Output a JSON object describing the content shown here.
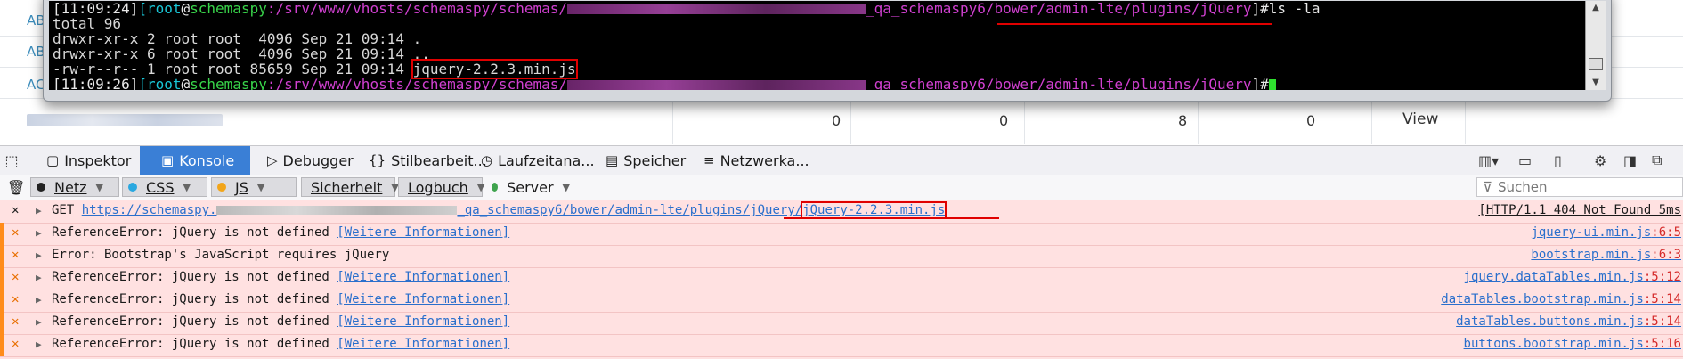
{
  "page": {
    "left_labels": [
      "AB",
      "AB",
      "AC"
    ],
    "numbers": [
      "0",
      "0",
      "8",
      "0"
    ],
    "view_link": "View"
  },
  "terminal": {
    "prompt1_time": "[11:09:24]",
    "prompt_user": "root",
    "prompt_at": "@",
    "prompt_host": "schemaspy",
    "prompt_path_prefix": ":/srv/www/vhosts/schemaspy/schemas/",
    "prompt_path_suffix": "_qa_schemaspy6/bower/admin-lte/plugins/jQuery",
    "prompt_end": "]#",
    "command": "ls -la",
    "lines": [
      "total 96",
      "drwxr-xr-x 2 root root  4096 Sep 21 09:14 .",
      "drwxr-xr-x 6 root root  4096 Sep 21 09:14 ..",
      "-rw-r--r-- 1 root root 85659 Sep 21 09:14 "
    ],
    "file_name": "jquery-2.2.3.min.js",
    "prompt2_time": "[11:09:26]",
    "prompt_bracket_open": "[",
    "scroll_up": "▲",
    "scroll_down": "▼"
  },
  "devtools": {
    "tabs": [
      {
        "icon": "▢",
        "label": "Inspektor"
      },
      {
        "icon": "▣",
        "label": "Konsole"
      },
      {
        "icon": "▷",
        "label": "Debugger"
      },
      {
        "icon": "{}",
        "label": "Stilbearbeit..."
      },
      {
        "icon": "◷",
        "label": "Laufzeitana..."
      },
      {
        "icon": "▤",
        "label": "Speicher"
      },
      {
        "icon": "≡",
        "label": "Netzwerka..."
      }
    ],
    "filters": [
      {
        "label": "Netz",
        "color": "#222222"
      },
      {
        "label": "CSS",
        "color": "#2aa8e0"
      },
      {
        "label": "JS",
        "color": "#f2a51a"
      },
      {
        "label": "Sicherheit",
        "color": "#e53b3b"
      },
      {
        "label": "Logbuch",
        "color": "#9a9a9a"
      },
      {
        "label": "Server",
        "color": "#3fa34d"
      }
    ],
    "search_placeholder": "Suchen",
    "trash_icon": "🗑",
    "filter_icon": "⊽"
  },
  "console": {
    "get_prefix": "GET ",
    "get_url_start": "https://schemaspy.",
    "get_url_mid": "_qa_schemaspy6/bower/admin-lte/plugins/jQuery/",
    "get_file": "jQuery-2.2.3.min.js",
    "get_status": "[HTTP/1.1 404 Not Found 5ms",
    "more_info": "[Weitere Informationen]",
    "rows": [
      {
        "msg": "ReferenceError: jQuery is not defined ",
        "link": true,
        "file": "jquery-ui.min.js",
        "line": ":6:5"
      },
      {
        "msg": "Error: Bootstrap's JavaScript requires jQuery",
        "link": false,
        "file": "bootstrap.min.js",
        "line": ":6:3"
      },
      {
        "msg": "ReferenceError: jQuery is not defined ",
        "link": true,
        "file": "jquery.dataTables.min.js",
        "line": ":5:12"
      },
      {
        "msg": "ReferenceError: jQuery is not defined ",
        "link": true,
        "file": "dataTables.bootstrap.min.js",
        "line": ":5:14"
      },
      {
        "msg": "ReferenceError: jQuery is not defined ",
        "link": true,
        "file": "dataTables.buttons.min.js",
        "line": ":5:14"
      },
      {
        "msg": "ReferenceError: jQuery is not defined ",
        "link": true,
        "file": "buttons.bootstrap.min.js",
        "line": ":5:16"
      }
    ]
  }
}
